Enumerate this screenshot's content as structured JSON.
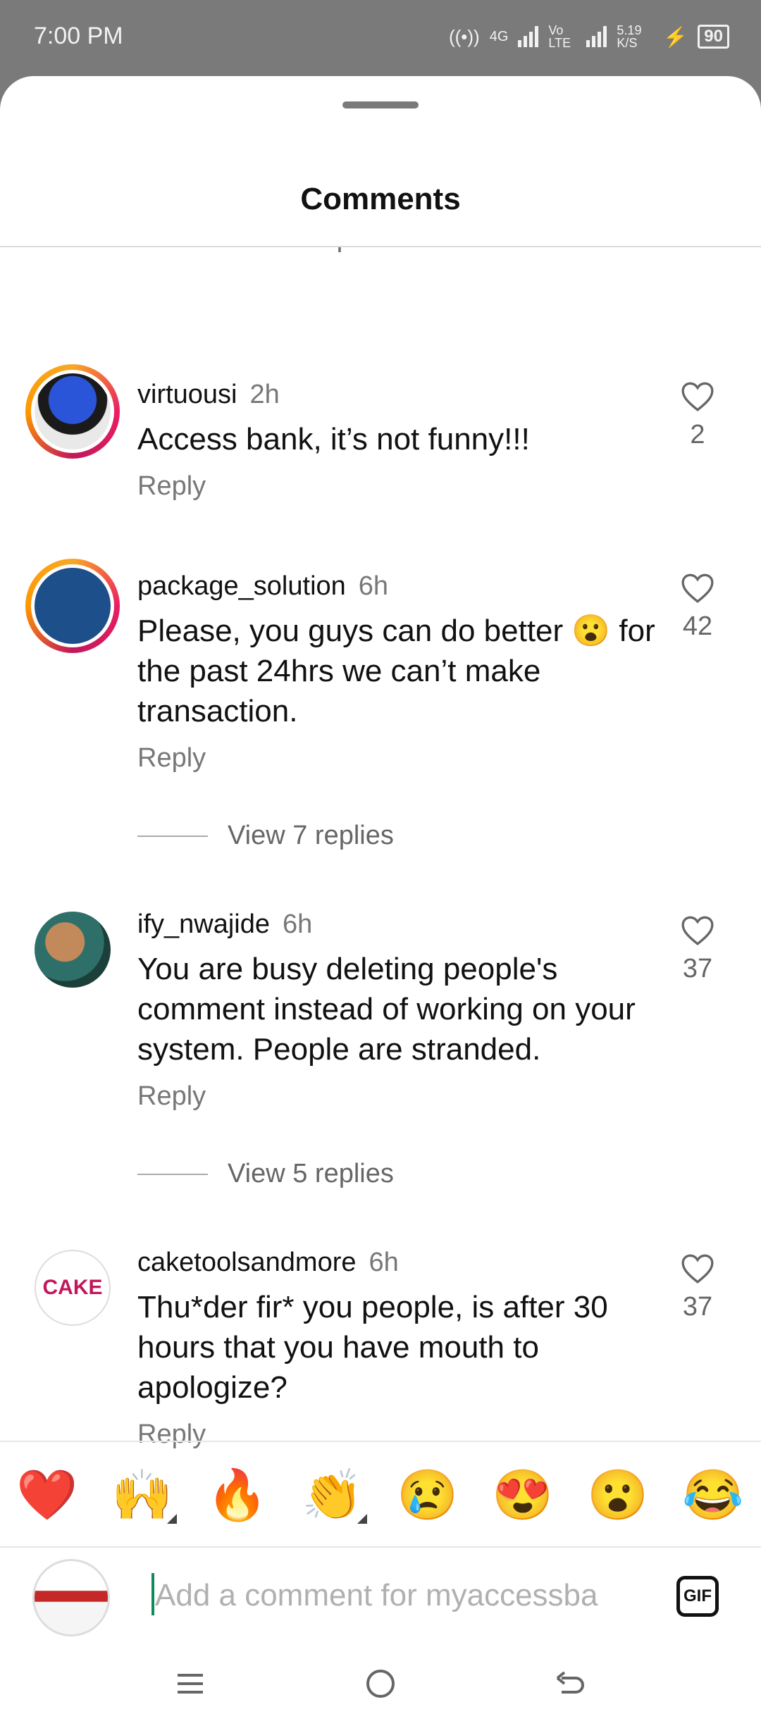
{
  "status": {
    "time": "7:00 PM",
    "network": "4G",
    "volte": "Vo LTE",
    "speed": "5.19 K/S",
    "battery": "90"
  },
  "sheet": {
    "title": "Comments",
    "partial_top": "View 7 replies"
  },
  "comments": [
    {
      "username": "virtuousi",
      "time": "2h",
      "text": "Access bank, it’s not funny!!!",
      "likes": "2",
      "reply": "Reply"
    },
    {
      "username": "package_solution",
      "time": "6h",
      "text": "Please, you guys can do better 😮 for the past 24hrs we can’t make transaction.",
      "likes": "42",
      "reply": "Reply",
      "view_replies": "View 7 replies"
    },
    {
      "username": "ify_nwajide",
      "time": "6h",
      "text": "You are busy deleting people's comment instead of working on your system. People are stranded.",
      "likes": "37",
      "reply": "Reply",
      "view_replies": "View 5 replies"
    },
    {
      "username": "caketoolsandmore",
      "time": "6h",
      "text": "Thu*der fir* you people, is after 30 hours that you have mouth to apologize?",
      "likes": "37",
      "reply": "Reply"
    }
  ],
  "emoji_bar": [
    "❤️",
    "🙌",
    "🔥",
    "👏",
    "😢",
    "😍",
    "😮",
    "😂"
  ],
  "composer": {
    "placeholder": "Add a comment for myaccessba",
    "gif": "GIF"
  },
  "colors": {
    "accent_cursor": "#0f8a5a",
    "story_ring": "#e91e63",
    "heart": "#e53935"
  }
}
